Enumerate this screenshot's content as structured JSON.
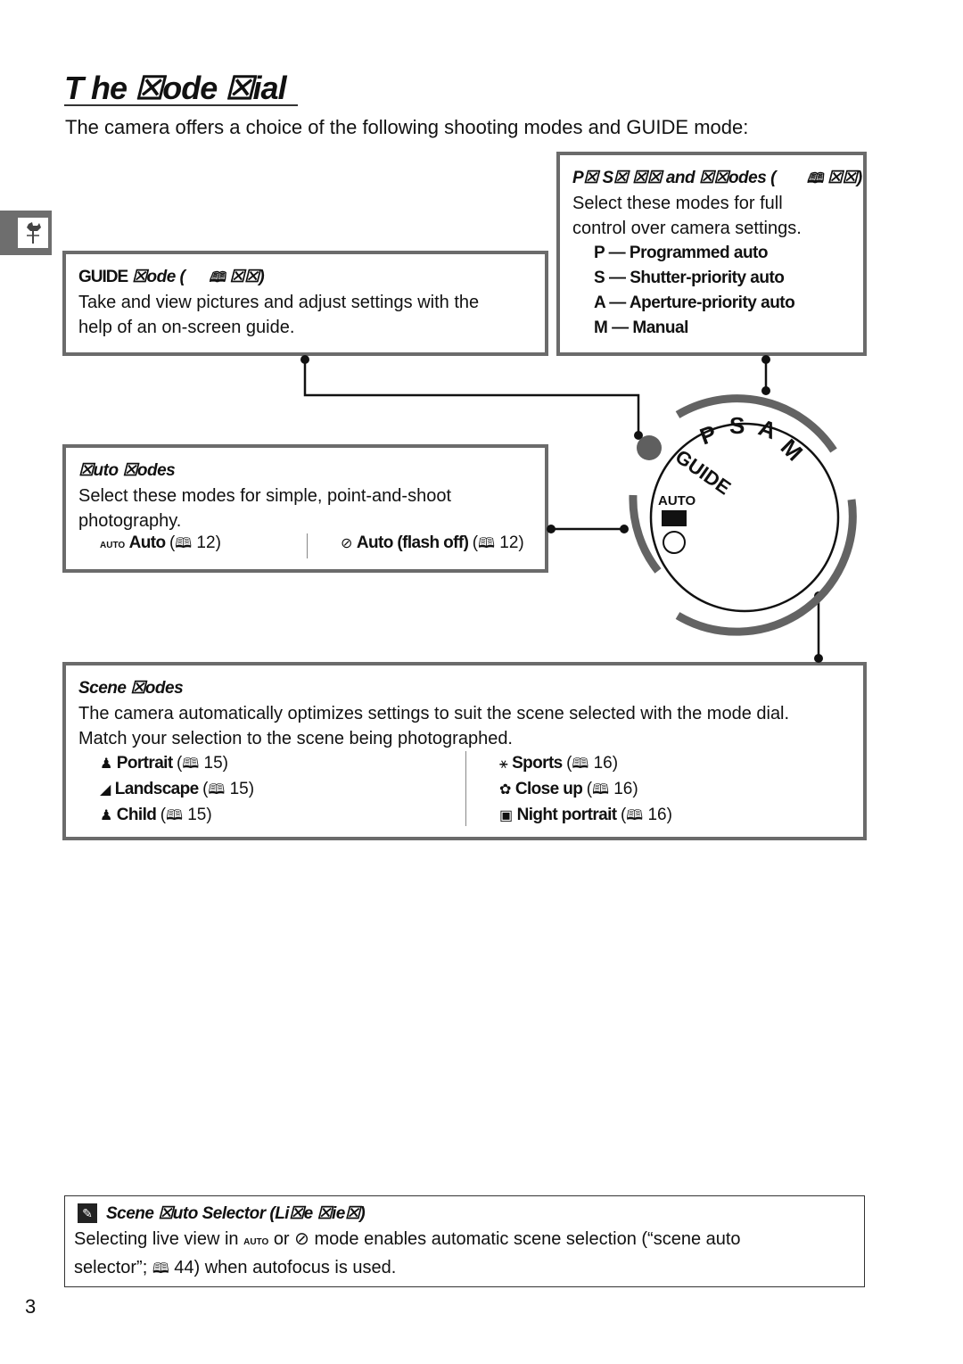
{
  "page": {
    "title": "T he ☒ode ☒ial",
    "intro": "The camera offers a choice of the following shooting modes and GUIDE mode:",
    "page_number": "3",
    "side_tab_icon": "rooster-weathervane-icon"
  },
  "psam": {
    "heading": "P☒ S☒ ☒☒ and ☒☒odes (",
    "heading_ref": "☒☒)",
    "text_line1": "Select these modes for full",
    "text_line2": "control over camera settings.",
    "modes": [
      {
        "key": "P",
        "label": "Programmed auto"
      },
      {
        "key": "S",
        "label": "Shutter-priority auto"
      },
      {
        "key": "A",
        "label": "Aperture-priority auto"
      },
      {
        "key": "M",
        "label": "Manual"
      }
    ]
  },
  "guide": {
    "heading_prefix": "GUIDE",
    "heading": "☒ode (",
    "heading_ref": "☒☒)",
    "text_line1": "Take and view pictures and adjust settings with the",
    "text_line2": "help of an on-screen guide."
  },
  "auto": {
    "heading": "☒uto ☒odes",
    "text_line1": "Select these modes for simple, point-and-shoot",
    "text_line2": "photography.",
    "items": [
      {
        "icon": "auto-camera-icon",
        "label": "Auto",
        "ref": "12"
      },
      {
        "icon": "flash-off-icon",
        "label": "Auto (flash off)",
        "ref": "12"
      }
    ]
  },
  "scene": {
    "heading": "Scene ☒odes",
    "text_line1": "The camera automatically optimizes settings to suit the scene selected with the mode dial.",
    "text_line2": "Match your selection to the scene being photographed.",
    "left": [
      {
        "icon": "portrait-icon",
        "label": "Portrait",
        "ref": "15"
      },
      {
        "icon": "landscape-icon",
        "label": "Landscape",
        "ref": "15"
      },
      {
        "icon": "child-icon",
        "label": "Child",
        "ref": "15"
      }
    ],
    "right": [
      {
        "icon": "sports-icon",
        "label": "Sports",
        "ref": "16"
      },
      {
        "icon": "close-up-icon",
        "label": "Close up",
        "ref": "16"
      },
      {
        "icon": "night-portrait-icon",
        "label": "Night portrait",
        "ref": "16"
      }
    ]
  },
  "dial": {
    "labels": [
      "P",
      "S",
      "A",
      "M",
      "GUIDE",
      "AUTO"
    ]
  },
  "note": {
    "heading": "Scene ☒uto Selector (Li☒e ☒ie☒)",
    "line1_pre": "Selecting live view in",
    "line1_mid": "or",
    "line1_post": "mode enables automatic scene selection (“scene auto",
    "line2_pre": "selector”;",
    "line2_ref": "44",
    "line2_post": ") when autofocus is used."
  },
  "glyphs": {
    "book": "🕮",
    "paren_open": "(",
    "paren_close": ")",
    "dash": "—"
  }
}
